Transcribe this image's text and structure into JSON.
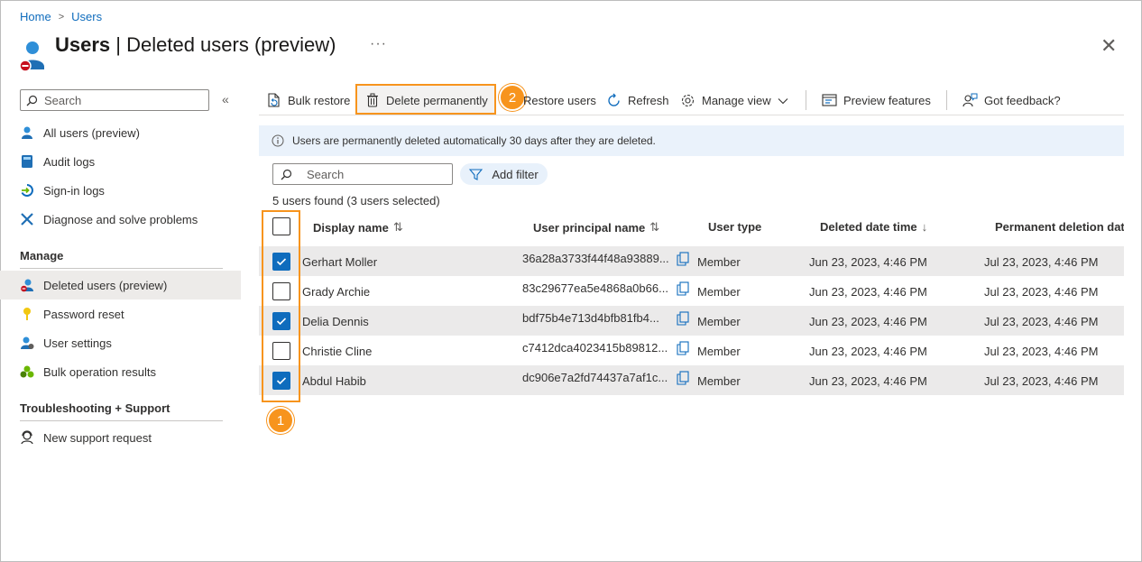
{
  "breadcrumb": {
    "home": "Home",
    "users": "Users"
  },
  "title": {
    "bold": "Users",
    "rest": " | Deleted users (preview)",
    "more": "···"
  },
  "sidebar": {
    "search_placeholder": "Search",
    "collapse": "«",
    "items": [
      {
        "label": "All users (preview)",
        "icon": "user-icon"
      },
      {
        "label": "Audit logs",
        "icon": "book-icon"
      },
      {
        "label": "Sign-in logs",
        "icon": "signin-icon"
      },
      {
        "label": "Diagnose and solve problems",
        "icon": "wrench-icon"
      }
    ],
    "manage_heading": "Manage",
    "manage_items": [
      {
        "label": "Deleted users (preview)",
        "icon": "deleted-user-icon",
        "active": true
      },
      {
        "label": "Password reset",
        "icon": "key-icon"
      },
      {
        "label": "User settings",
        "icon": "user-settings-icon"
      },
      {
        "label": "Bulk operation results",
        "icon": "bulk-icon"
      }
    ],
    "support_heading": "Troubleshooting + Support",
    "support_items": [
      {
        "label": "New support request",
        "icon": "support-icon"
      }
    ]
  },
  "toolbar": {
    "bulk_restore": "Bulk restore",
    "delete_permanently": "Delete permanently",
    "restore_users": "Restore users",
    "refresh": "Refresh",
    "manage_view": "Manage view",
    "preview_features": "Preview features",
    "got_feedback": "Got feedback?"
  },
  "callouts": {
    "one": "1",
    "two": "2"
  },
  "info_message": "Users are permanently deleted automatically 30 days after they are deleted.",
  "search": {
    "placeholder": "Search"
  },
  "add_filter": "Add filter",
  "results_count": "5 users found (3 users selected)",
  "table": {
    "columns": {
      "display_name": "Display name",
      "upn": "User principal name",
      "user_type": "User type",
      "deleted": "Deleted date time",
      "permanent": "Permanent deletion date"
    },
    "rows": [
      {
        "name": "Gerhart Moller",
        "upn": "36a28a3733f44f48a93889...",
        "type": "Member",
        "deleted": "Jun 23, 2023, 4:46 PM",
        "permanent": "Jul 23, 2023, 4:46 PM",
        "checked": true
      },
      {
        "name": "Grady Archie",
        "upn": "83c29677ea5e4868a0b66...",
        "type": "Member",
        "deleted": "Jun 23, 2023, 4:46 PM",
        "permanent": "Jul 23, 2023, 4:46 PM",
        "checked": false
      },
      {
        "name": "Delia Dennis",
        "upn": "bdf75b4e713d4bfb81fb4...",
        "type": "Member",
        "deleted": "Jun 23, 2023, 4:46 PM",
        "permanent": "Jul 23, 2023, 4:46 PM",
        "checked": true
      },
      {
        "name": "Christie Cline",
        "upn": "c7412dca4023415b89812...",
        "type": "Member",
        "deleted": "Jun 23, 2023, 4:46 PM",
        "permanent": "Jul 23, 2023, 4:46 PM",
        "checked": false
      },
      {
        "name": "Abdul Habib",
        "upn": "dc906e7a2fd74437a7af1c...",
        "type": "Member",
        "deleted": "Jun 23, 2023, 4:46 PM",
        "permanent": "Jul 23, 2023, 4:46 PM",
        "checked": true
      }
    ]
  },
  "colors": {
    "accent": "#0f6cbd",
    "callout": "#f7941d",
    "selected_row": "#ebeaea",
    "info_bg": "#eaf2fb"
  }
}
